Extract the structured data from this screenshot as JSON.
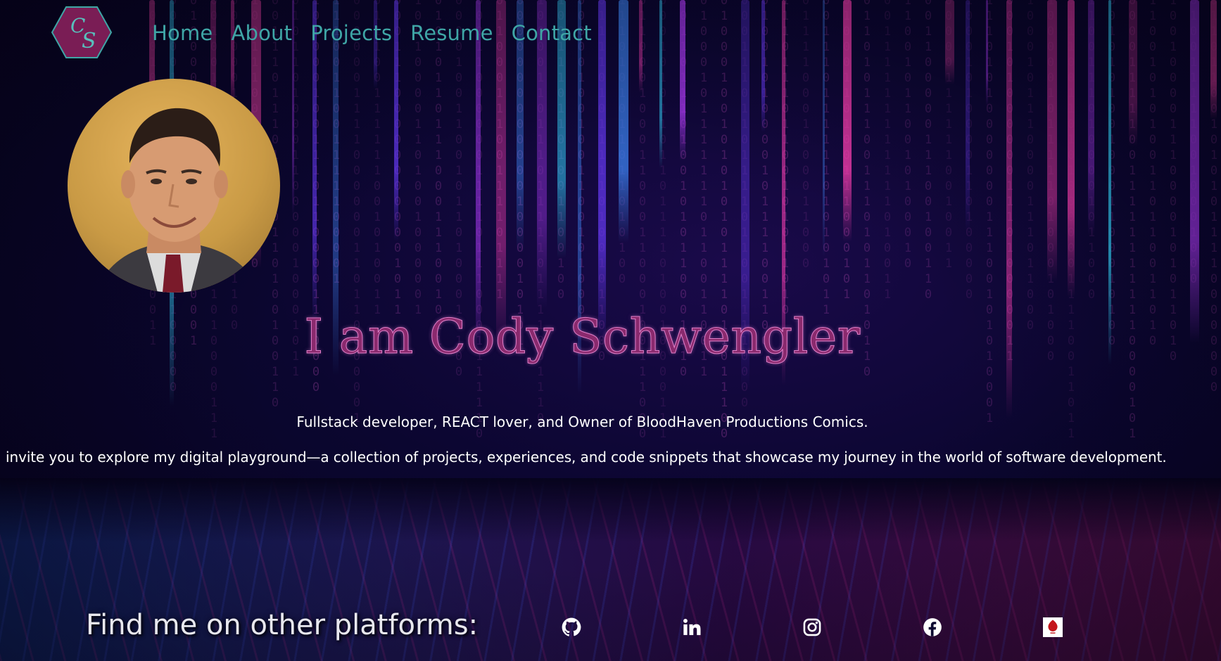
{
  "nav": {
    "logo_alt": "CS logo",
    "items": [
      {
        "label": "Home"
      },
      {
        "label": "About"
      },
      {
        "label": "Projects"
      },
      {
        "label": "Resume"
      },
      {
        "label": "Contact"
      }
    ]
  },
  "hero": {
    "title": "I am Cody Schwengler",
    "tagline": "Fullstack developer, REACT lover, and Owner of BloodHaven Productions Comics.",
    "intro": "I invite you to explore my digital playground—a collection of projects, experiences, and code snippets that showcase my journey in the world of software development."
  },
  "platforms": {
    "label": "Find me on other platforms:",
    "links": [
      {
        "icon": "github-icon"
      },
      {
        "icon": "linkedin-icon"
      },
      {
        "icon": "instagram-icon"
      },
      {
        "icon": "facebook-icon"
      },
      {
        "icon": "bloodhaven-icon"
      }
    ]
  },
  "colors": {
    "nav_link": "#3fa6a6",
    "title": "#8a2a6e",
    "title_outline": "#e07fc8",
    "logo_fill": "#7a1d55",
    "background": "#0a0526"
  }
}
